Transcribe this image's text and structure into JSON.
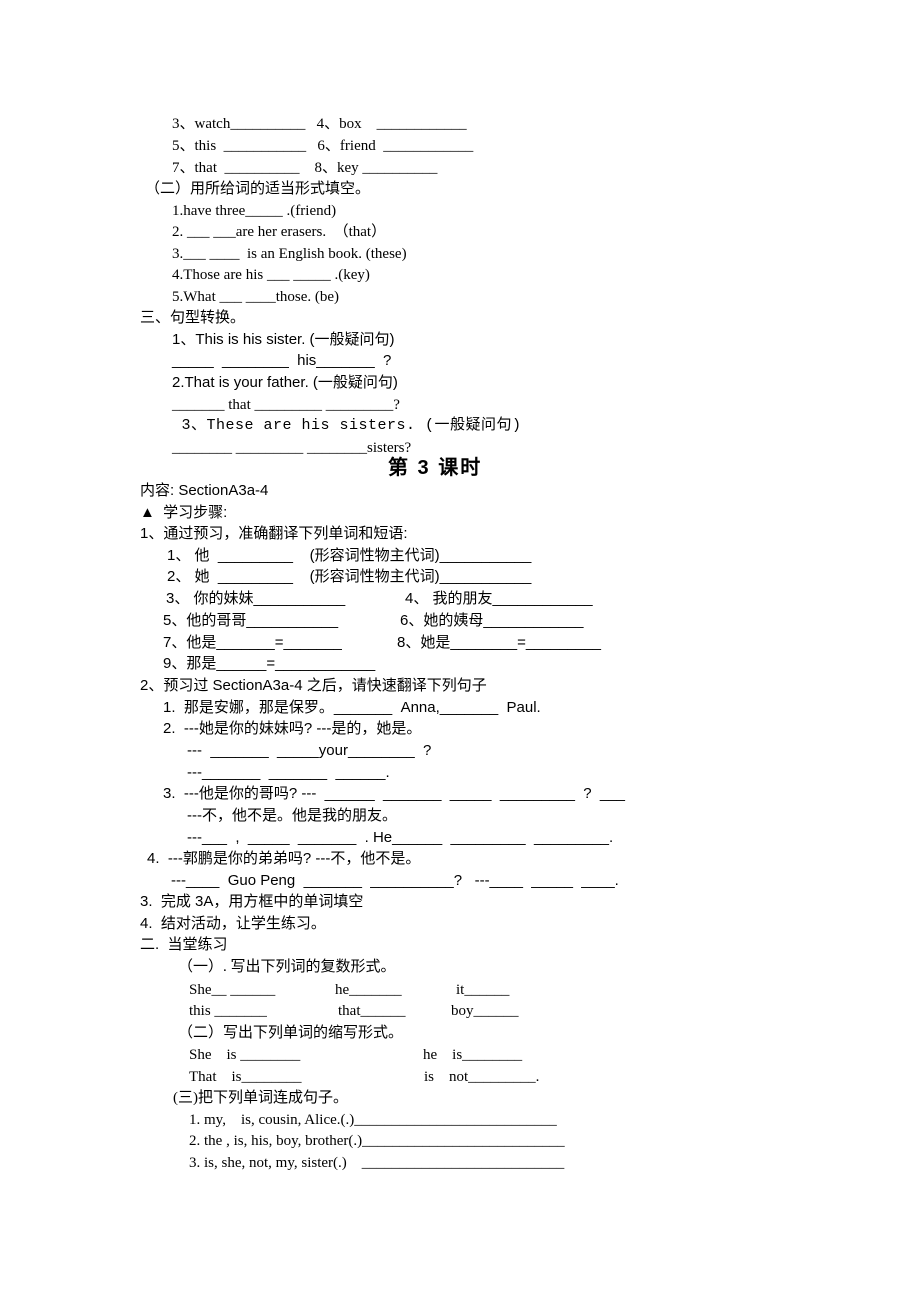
{
  "part1": {
    "vocab_rows": [
      "3、watch__________   4、box    ____________",
      "5、this  ___________   6、friend  ____________",
      "7、that  __________    8、key __________"
    ],
    "section2_heading": "（二）用所给词的适当形式填空。",
    "fill_items": [
      "1.have three_____ .(friend)",
      "2. ___ ___are her erasers.  （that）",
      "3.___ ____  is an English book. (these)",
      "4.Those are his ___ _____ .(key)",
      "5.What ___ ____those. (be)"
    ],
    "section3_heading": "三、句型转换。",
    "transform": [
      {
        "prompt": "1、This is his sister. (一般疑问句)",
        "answer": "_____  ________  his_______  ?"
      },
      {
        "prompt": "2.That is your father. (一般疑问句)",
        "answer": "_______ that _________ _________?"
      },
      {
        "prompt": " 3、These are his sisters. (一般疑问句)",
        "answer": "________ _________ ________sisters?"
      }
    ]
  },
  "lesson3": {
    "title": "第 3 课时",
    "content_line": "内容: SectionA3a-4",
    "steps_heading": "▲  学习步骤:",
    "step1_heading": "1、通过预习，准确翻译下列单词和短语:",
    "step1_items": [
      "1、 他  _________    (形容词性物主代词)___________",
      "2、 她  _________    (形容词性物主代词)___________",
      "3、 你的妹妹___________",
      "4、 我的朋友____________",
      "5、他的哥哥___________",
      "6、她的姨母____________",
      "7、他是_______=_______",
      "8、她是________=_________",
      "9、那是______=____________"
    ],
    "step2_heading": "2、预习过 SectionA3a-4 之后，请快速翻译下列句子",
    "step2_lines": [
      "1.  那是安娜，那是保罗。_______  Anna,_______  Paul.",
      "2.  ---她是你的妹妹吗? ---是的，她是。",
      "---  _______  _____your________  ?",
      "---_______  _______  ______.",
      "3.  ---他是你的哥吗? ---  ______  _______  _____  _________  ?  ___",
      "---不，他不是。他是我的朋友。",
      "---___  ,  _____  _______  . He______  _________  _________.",
      "4.  ---郭鹏是你的弟弟吗? ---不，他不是。",
      "---____  Guo Peng  _______  __________?   ---____  _____  ____."
    ],
    "step3": "3.  完成 3A，用方框中的单词填空",
    "step4": "4.  结对活动，让学生练习。",
    "practice_heading": "二.  当堂练习",
    "plural_heading": "（一）. 写出下列词的复数形式。",
    "plural_rows": [
      [
        "She__ ______",
        "he_______",
        "it______"
      ],
      [
        "this _______",
        "that______",
        "boy______"
      ]
    ],
    "contraction_heading": "（二）写出下列单词的缩写形式。",
    "contraction_rows": [
      [
        "She    is ________",
        "he    is________"
      ],
      [
        "That    is________",
        "is    not_________."
      ]
    ],
    "sentence_heading": "(三)把下列单词连成句子。",
    "sentence_items": [
      "1. my,    is, cousin, Alice.(.)___________________________",
      "2. the , is, his, boy, brother(.)___________________________",
      "3. is, she, not, my, sister(.)    ___________________________"
    ]
  }
}
